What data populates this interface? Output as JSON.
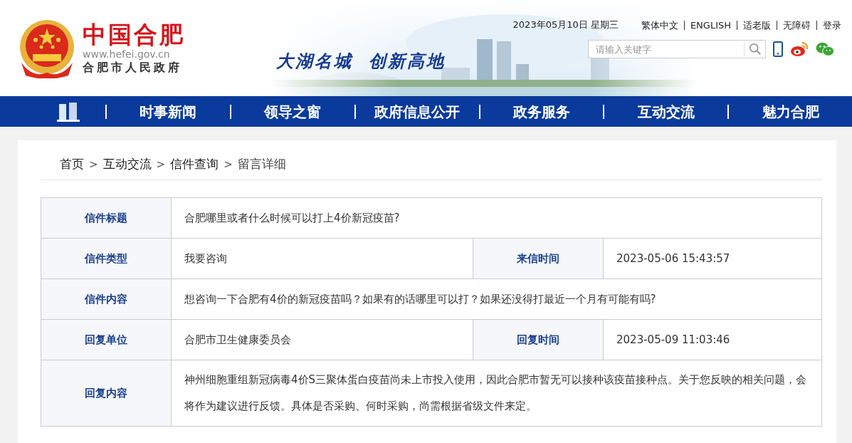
{
  "header": {
    "site_name": "中国合肥",
    "url": "www.hefei.gov.cn",
    "org": "合肥市人民政府",
    "slogan": [
      "大湖名城",
      "创新高地"
    ],
    "date": "2023年05月10日 星期三",
    "top_links": [
      "繁体中文",
      "ENGLISH",
      "适老版",
      "无障碍",
      "登录"
    ],
    "search": {
      "placeholder": "请输入关键字"
    }
  },
  "nav": {
    "items": [
      {
        "label": "时事新闻",
        "selected": false
      },
      {
        "label": "领导之窗",
        "selected": false
      },
      {
        "label": "政府信息公开",
        "selected": false
      },
      {
        "label": "政务服务",
        "selected": false
      },
      {
        "label": "互动交流",
        "selected": false
      },
      {
        "label": "魅力合肥",
        "selected": false
      }
    ]
  },
  "breadcrumb": [
    {
      "kind": "link",
      "text": "首页"
    },
    {
      "kind": "sep",
      "text": ">"
    },
    {
      "kind": "link",
      "text": "互动交流"
    },
    {
      "kind": "sep",
      "text": ">"
    },
    {
      "kind": "link",
      "text": "信件查询"
    },
    {
      "kind": "sep",
      "text": ">"
    },
    {
      "kind": "current",
      "text": "留言详细"
    }
  ],
  "table": {
    "rows": [
      {
        "cells": [
          {
            "kind": "label",
            "text": "信件标题"
          },
          {
            "kind": "value",
            "text": "合肥哪里或者什么时候可以打上4价新冠疫苗?"
          }
        ]
      },
      {
        "cells": [
          {
            "kind": "label",
            "text": "信件类型"
          },
          {
            "kind": "value",
            "text": "我要咨询"
          },
          {
            "kind": "label",
            "text": "来信时间"
          },
          {
            "kind": "value",
            "text": "2023-05-06 15:43:57"
          }
        ]
      },
      {
        "cells": [
          {
            "kind": "label",
            "text": "信件内容"
          },
          {
            "kind": "value",
            "text": "想咨询一下合肥有4价的新冠疫苗吗？如果有的话哪里可以打？如果还没得打最近一个月有可能有吗?"
          }
        ]
      },
      {
        "cells": [
          {
            "kind": "label",
            "text": "回复单位"
          },
          {
            "kind": "value",
            "text": "合肥市卫生健康委员会"
          },
          {
            "kind": "label",
            "text": "回复时间"
          },
          {
            "kind": "value",
            "text": "2023-05-09 11:03:46"
          }
        ]
      },
      {
        "cells": [
          {
            "kind": "label",
            "text": "回复内容"
          },
          {
            "kind": "value",
            "text": "神州细胞重组新冠病毒4价S三聚体蛋白疫苗尚未上市投入使用，因此合肥市暂无可以接种该疫苗接种点。关于您反映的相关问题，会将作为建议进行反馈。具体是否采购、何时采购，尚需根据省级文件来定。"
          }
        ]
      }
    ]
  }
}
